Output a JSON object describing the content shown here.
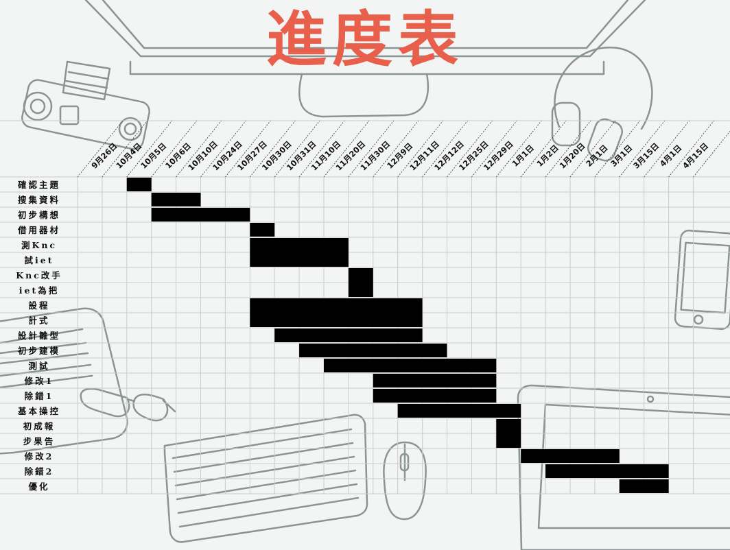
{
  "title": "進度表",
  "chart_data": {
    "type": "gantt",
    "dates": [
      "9月26日",
      "10月4日",
      "10月5日",
      "10月6日",
      "10月10日",
      "10月24日",
      "10月27日",
      "10月30日",
      "10月31日",
      "11月10日",
      "11月20日",
      "11月30日",
      "12月9日",
      "12月11日",
      "12月12日",
      "12月25日",
      "12月29日",
      "1月1日",
      "1月2日",
      "1月20日",
      "2月1日",
      "3月1日",
      "3月15日",
      "4月1日",
      "4月15日"
    ],
    "tasks": [
      {
        "label": [
          "確認主題"
        ],
        "start": "10月5日",
        "end": "10月6日"
      },
      {
        "label": [
          "搜集資料"
        ],
        "start": "10月6日",
        "end": "10月24日"
      },
      {
        "label": [
          "初步構想"
        ],
        "start": "10月6日",
        "end": "10月30日"
      },
      {
        "label": [
          "借用器材"
        ],
        "start": "10月30日",
        "end": "10月31日"
      },
      {
        "label": [
          "測Knc",
          "試iet"
        ],
        "start": "10月30日",
        "end": "11月30日"
      },
      {
        "label": [
          "Knc改手",
          "iet為把"
        ],
        "start": "11月30日",
        "end": "12月9日"
      },
      {
        "label": [
          "設程",
          "計式"
        ],
        "start": "10月30日",
        "end": "12月12日"
      },
      {
        "label": [
          "設計雛型"
        ],
        "start": "10月31日",
        "end": "12月12日"
      },
      {
        "label": [
          "初步建模"
        ],
        "start": "11月10日",
        "end": "12月25日"
      },
      {
        "label": [
          "測試"
        ],
        "start": "11月20日",
        "end": "1月1日"
      },
      {
        "label": [
          "修改1"
        ],
        "start": "12月9日",
        "end": "1月1日"
      },
      {
        "label": [
          "除錯1"
        ],
        "start": "12月9日",
        "end": "1月1日"
      },
      {
        "label": [
          "基本操控"
        ],
        "start": "12月11日",
        "end": "1月2日"
      },
      {
        "label": [
          "初成報",
          "步果告"
        ],
        "start": "1月1日",
        "end": "1月2日"
      },
      {
        "label": [
          "修改2"
        ],
        "start": "1月2日",
        "end": "3月15日"
      },
      {
        "label": [
          "除錯2"
        ],
        "start": "1月20日",
        "end": "4月15日"
      },
      {
        "label": [
          "優化"
        ],
        "start": "3月15日",
        "end": "4月15日"
      }
    ],
    "bar_color": "#000000",
    "grid": true
  }
}
